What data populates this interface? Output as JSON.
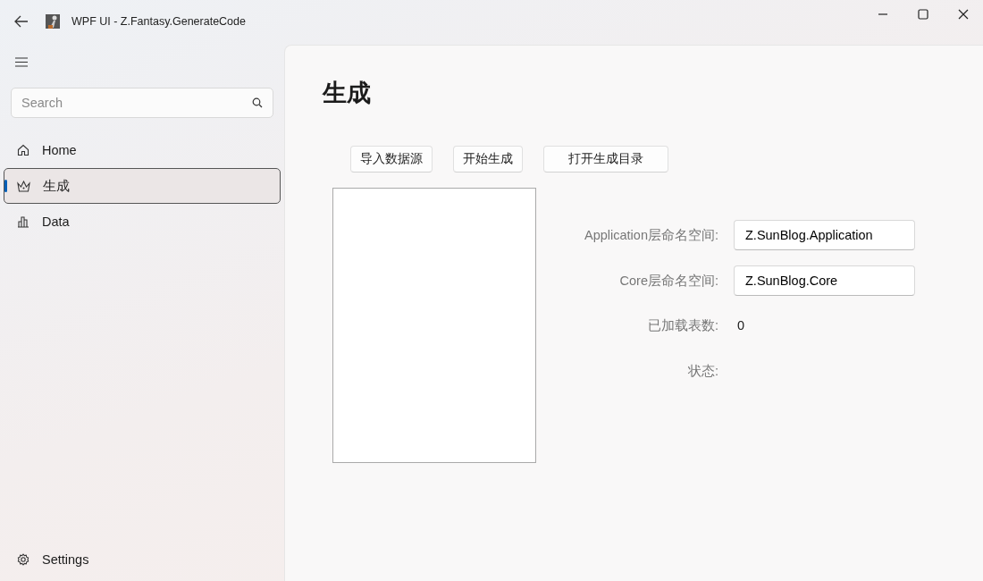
{
  "window": {
    "title": "WPF UI - Z.Fantasy.GenerateCode"
  },
  "sidebar": {
    "search": {
      "placeholder": "Search"
    },
    "items": [
      {
        "label": "Home",
        "selected": false
      },
      {
        "label": "生成",
        "selected": true
      },
      {
        "label": "Data",
        "selected": false
      }
    ],
    "footer_item": {
      "label": "Settings"
    }
  },
  "page": {
    "heading": "生成",
    "buttons": [
      "导入数据源",
      "开始生成",
      "打开生成目录"
    ],
    "form": [
      {
        "kind": "field",
        "label": "Application层命名空间:",
        "value": "Z.SunBlog.Application"
      },
      {
        "kind": "field",
        "label": "Core层命名空间:",
        "value": "Z.SunBlog.Core"
      },
      {
        "kind": "text",
        "label": "已加载表数:",
        "value": "0"
      },
      {
        "kind": "text",
        "label": "状态:"
      }
    ]
  }
}
